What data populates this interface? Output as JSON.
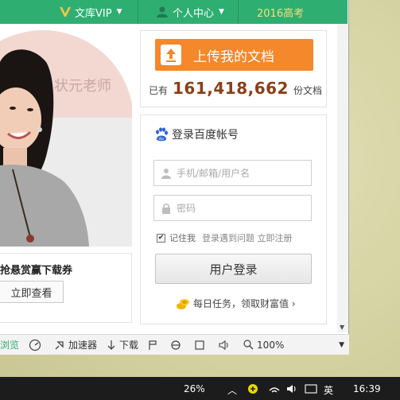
{
  "colors": {
    "nav": "#2fae72",
    "upload": "#f4882a",
    "count": "#8b3f19",
    "gaokao": "#f2e07a"
  },
  "topnav": {
    "vip_label": "文库VIP",
    "personal_label": "个人中心",
    "gaokao_label": "2016高考",
    "icons": [
      "vip-crown-icon",
      "user-icon"
    ]
  },
  "banner": {
    "teacher_label": "状元老师",
    "promo_text": "抢悬赏赢下载券",
    "promo_button": "立即查看"
  },
  "upload": {
    "button_label": "上传我的文档",
    "prefix": "已有",
    "count": "161,418,662",
    "suffix": "份文档",
    "icon": "upload-icon"
  },
  "login": {
    "title": "登录百度帐号",
    "username_placeholder": "手机/邮箱/用户名",
    "password_placeholder": "密码",
    "remember_label": "记住我",
    "remember_checked": true,
    "help_links": "登录遇到问题 立即注册",
    "login_button": "用户登录",
    "task_text": "每日任务，领取财富值 ›",
    "icons": [
      "baidu-paw-icon",
      "user-icon",
      "lock-icon",
      "coin-icon"
    ]
  },
  "statusbar": {
    "browse_label": "浏览",
    "accelerator_label": "加速器",
    "download_label": "下载",
    "zoom_label": "100%",
    "icons": [
      "speed-icon",
      "accelerator-icon",
      "download-icon",
      "flag-icon",
      "ie-icon",
      "window-icon",
      "volume-icon",
      "zoom-icon"
    ]
  },
  "taskbar": {
    "battery_percent": "26%",
    "ime_label": "英",
    "time": "16:39"
  }
}
